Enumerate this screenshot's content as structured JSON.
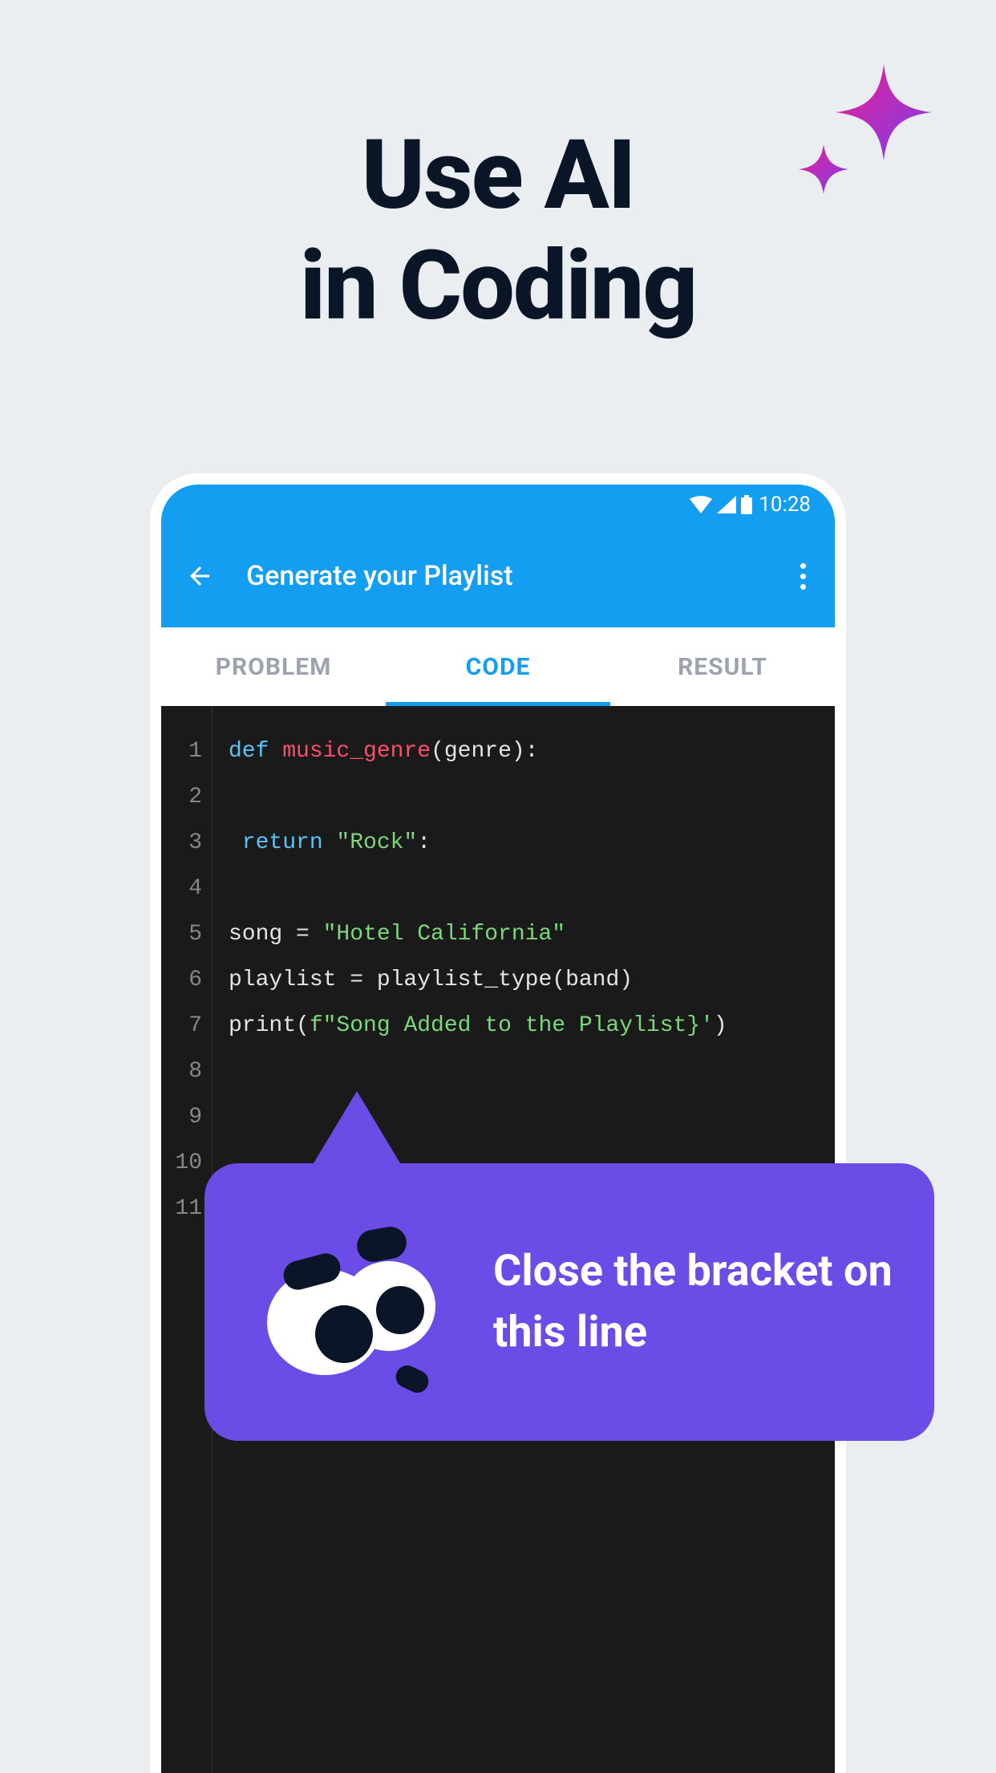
{
  "headline": {
    "line1": "Use AI",
    "line2": "in Coding"
  },
  "status_bar": {
    "time": "10:28"
  },
  "app_bar": {
    "title": "Generate your Playlist"
  },
  "tabs": [
    {
      "label": "PROBLEM",
      "active": false
    },
    {
      "label": "CODE",
      "active": true
    },
    {
      "label": "RESULT",
      "active": false
    }
  ],
  "code": {
    "line_numbers": [
      "1",
      "2",
      "3",
      "4",
      "5",
      "6",
      "7",
      "8",
      "9",
      "10",
      "11"
    ],
    "l1": {
      "def": "def ",
      "fn": "music_genre",
      "rest": "(genre):"
    },
    "l3": {
      "ret": " return ",
      "str": "\"Rock\"",
      "rest": ":"
    },
    "l5": {
      "pre": "song = ",
      "str": "\"Hotel California\""
    },
    "l6": "playlist = playlist_type(band)",
    "l7": {
      "pre": "print(",
      "f": "f\"Song Added to the Playlist}'",
      "rest": ")"
    }
  },
  "hint": {
    "text": "Close the bracket on this line"
  }
}
